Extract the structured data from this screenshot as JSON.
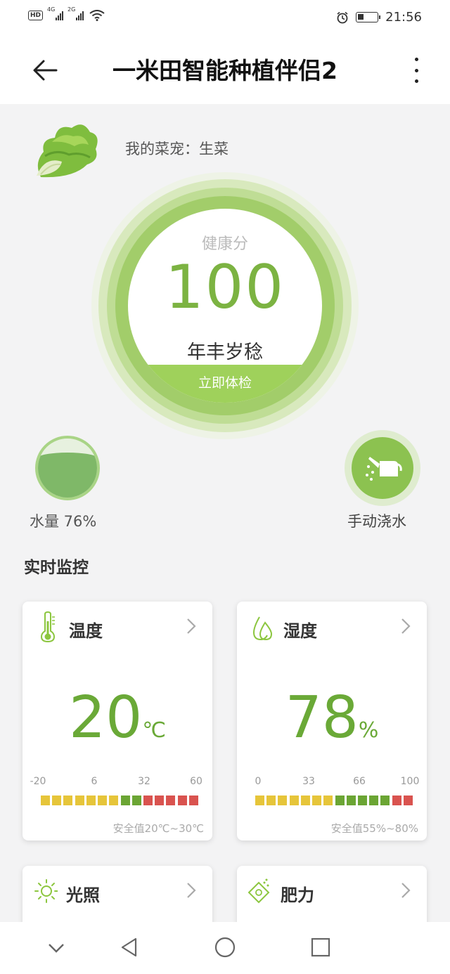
{
  "statusbar": {
    "left_indicators": [
      "HD",
      "4G",
      "2G",
      "wifi-icon"
    ],
    "time": "21:56",
    "battery_level": 0.3
  },
  "header": {
    "title": "一米田智能种植伴侣2",
    "back_icon": "back-arrow-icon",
    "more_icon": "more-vertical-icon"
  },
  "plant": {
    "label": "我的菜宠：生菜"
  },
  "health": {
    "label": "健康分",
    "score": "100",
    "description": "年丰岁稔",
    "check_button": "立即体检"
  },
  "water": {
    "label": "水量 76%",
    "level": 0.76
  },
  "manual_water": {
    "label": "手动浇水",
    "icon": "watering-can-icon"
  },
  "monitor": {
    "title": "实时监控",
    "cards": [
      {
        "title": "温度",
        "icon": "thermometer-icon",
        "value": "20",
        "unit": "℃",
        "scale": [
          "-20",
          "6",
          "32",
          "60"
        ],
        "safe": "安全值20℃~30℃"
      },
      {
        "title": "湿度",
        "icon": "water-drops-icon",
        "value": "78",
        "unit": "%",
        "scale": [
          "0",
          "33",
          "66",
          "100"
        ],
        "safe": "安全值55%~80%"
      },
      {
        "title": "光照",
        "icon": "sun-icon"
      },
      {
        "title": "肥力",
        "icon": "fertilizer-icon"
      }
    ]
  },
  "colors": {
    "accent": "#7cb342",
    "scale_yellow": "#e6c53a",
    "scale_green": "#6ba534",
    "scale_red": "#d9534f"
  },
  "navbar": [
    "collapse-icon",
    "back-triangle-icon",
    "home-circle-icon",
    "recents-square-icon"
  ]
}
